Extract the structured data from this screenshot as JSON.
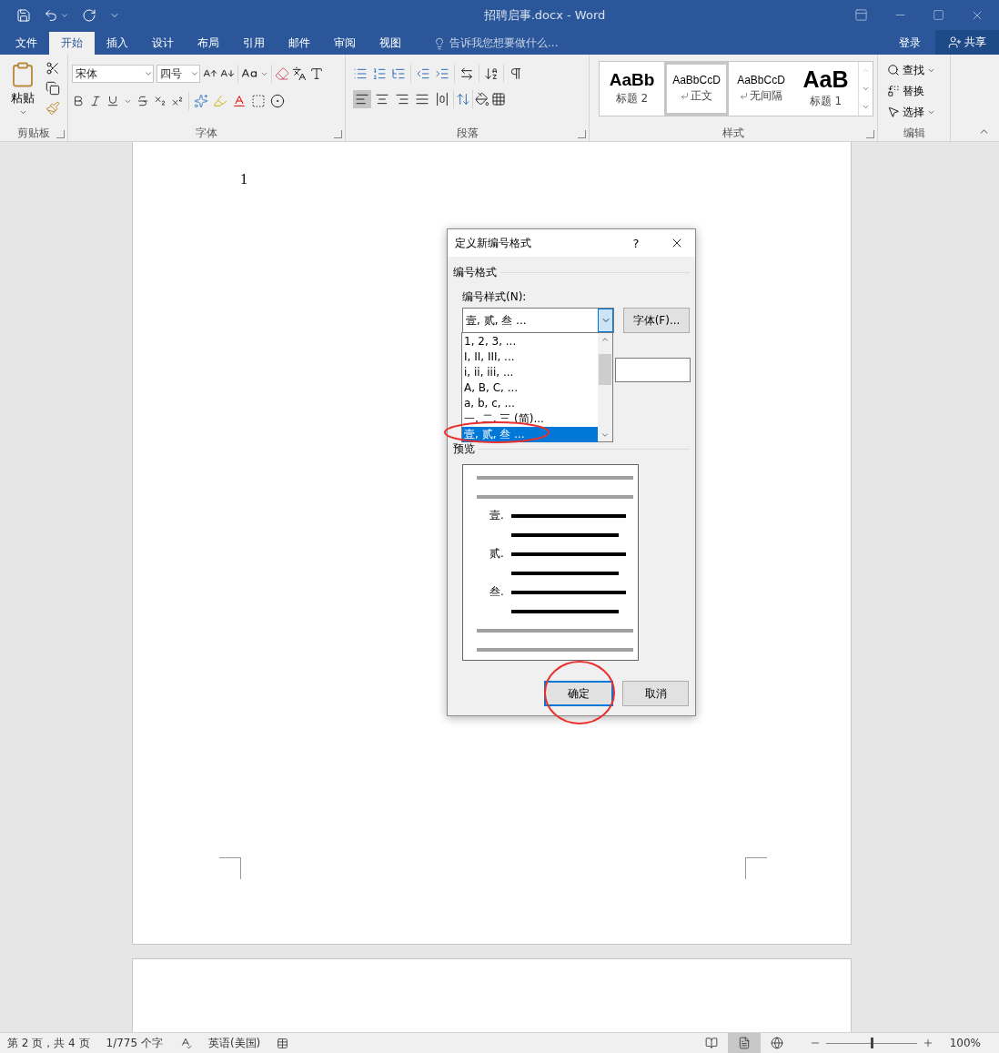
{
  "title_bar": {
    "title": "招聘启事.docx - Word"
  },
  "menu": {
    "tabs": [
      {
        "label": "文件",
        "selected": false
      },
      {
        "label": "开始",
        "selected": true
      },
      {
        "label": "插入",
        "selected": false
      },
      {
        "label": "设计",
        "selected": false
      },
      {
        "label": "布局",
        "selected": false
      },
      {
        "label": "引用",
        "selected": false
      },
      {
        "label": "邮件",
        "selected": false
      },
      {
        "label": "审阅",
        "selected": false
      },
      {
        "label": "视图",
        "selected": false
      }
    ],
    "tell_me": "告诉我您想要做什么...",
    "sign_in": "登录",
    "share": "共享"
  },
  "ribbon": {
    "clipboard": {
      "paste": "粘贴",
      "label": "剪贴板"
    },
    "font": {
      "font_name": "宋体",
      "font_size": "四号",
      "label": "字体"
    },
    "paragraph": {
      "label": "段落",
      "alignment": [
        {
          "selected": true
        },
        {
          "selected": false
        },
        {
          "selected": false
        },
        {
          "selected": false
        },
        {
          "selected": false
        }
      ]
    },
    "styles": {
      "label": "样式",
      "items": [
        {
          "preview": "AaBb",
          "name": "标题 2",
          "kind": "heading2",
          "selected": false,
          "para_mark": false
        },
        {
          "preview": "AaBbCcD",
          "name": "正文",
          "kind": "normal",
          "selected": true,
          "para_mark": true
        },
        {
          "preview": "AaBbCcD",
          "name": "无间隔",
          "kind": "normal",
          "selected": false,
          "para_mark": true
        },
        {
          "preview": "AaB",
          "name": "标题 1",
          "kind": "heading1",
          "selected": false,
          "para_mark": false
        }
      ]
    },
    "editing": {
      "label": "编辑",
      "items": [
        {
          "label": "查找",
          "menu": true
        },
        {
          "label": "替换",
          "menu": false
        },
        {
          "label": "选择",
          "menu": true
        }
      ]
    }
  },
  "document": {
    "page_text": "1"
  },
  "dialog": {
    "title": "定义新编号格式",
    "help": "?",
    "section": "编号格式",
    "style_label": "编号样式(N):",
    "style_value": "壹, 贰, 叁 ...",
    "font_button": "字体(F)...",
    "options": [
      {
        "label": "1, 2, 3, ...",
        "selected": false
      },
      {
        "label": "I, II, III, ...",
        "selected": false
      },
      {
        "label": "i, ii, iii, ...",
        "selected": false
      },
      {
        "label": "A, B, C, ...",
        "selected": false
      },
      {
        "label": "a, b, c, ...",
        "selected": false
      },
      {
        "label": "一, 二, 三 (简)...",
        "selected": false
      },
      {
        "label": "壹, 贰, 叁 ...",
        "selected": true
      }
    ],
    "preview_label": "预览",
    "preview_numbers": [
      "壹.",
      "贰.",
      "叁."
    ],
    "ok": "确定",
    "cancel": "取消"
  },
  "status_bar": {
    "page": "第 2 页，共 4 页",
    "words": "1/775 个字",
    "language": "英语(美国)",
    "views": [
      {
        "selected": false
      },
      {
        "selected": true
      },
      {
        "selected": false
      }
    ],
    "zoom": {
      "level": 0.5,
      "reading": "100%"
    }
  }
}
